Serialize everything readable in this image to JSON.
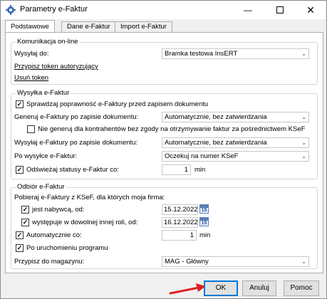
{
  "window": {
    "title": "Parametry e-Faktur",
    "close_glyph": "✕",
    "min_glyph": "—"
  },
  "tabs": [
    {
      "label": "Podstawowe",
      "active": true
    },
    {
      "label": "Dane e-Faktur",
      "active": false
    },
    {
      "label": "Import e-Faktur",
      "active": false
    }
  ],
  "komunikacja": {
    "title": "Komunikacja on-line",
    "send_to_label": "Wysyłaj do:",
    "send_to_value": "Bramka testowa InsERT",
    "assign_token_link": "Przypisz token autoryzujący",
    "remove_token_link": "Usuń token"
  },
  "wysylka": {
    "title": "Wysyłka e-Faktur",
    "validate_label": "Sprawdzaj poprawność e-Faktury przed zapisem dokumentu",
    "validate_checked": true,
    "generate_label": "Generuj e-Faktury po zapisie dokumentu:",
    "generate_value": "Automatycznie, bez zatwierdzania",
    "no_consent_label": "Nie generuj dla kontrahentów bez zgody na otrzymywanie faktur za pośrednictwem KSeF",
    "no_consent_checked": false,
    "send_after_save_label": "Wysyłaj e-Faktury po zapisie dokumentu:",
    "send_after_save_value": "Automatycznie, bez zatwierdzania",
    "after_send_label": "Po wysyłce e-Faktur:",
    "after_send_value": "Oczekuj na numer KSeF",
    "refresh_label": "Odświeżaj statusy e-Faktur co:",
    "refresh_checked": true,
    "refresh_value": "1",
    "refresh_unit": "min"
  },
  "odbior": {
    "title": "Odbiór  e-Faktur",
    "fetch_label": "Pobieraj e-Faktury z KSeF, dla których moja firma:",
    "buyer_label": "jest nabywcą, od:",
    "buyer_checked": true,
    "buyer_date": "15.12.2022",
    "other_role_label": "występuje w dowolnej innej roli, od:",
    "other_role_checked": true,
    "other_role_date": "16.12.2022",
    "calendar_day": "15",
    "auto_label": "Automatycznie co:",
    "auto_checked": true,
    "auto_value": "1",
    "auto_unit": "min",
    "on_start_label": "Po uruchomieniu programu",
    "on_start_checked": true,
    "warehouse_label": "Przypisz do magazynu:",
    "warehouse_value": "MAG - Główny"
  },
  "buttons": {
    "ok": "OK",
    "cancel": "Anuluj",
    "help": "Pomoc"
  },
  "colors": {
    "accent": "#0078d7",
    "annotation_arrow": "#e02020"
  }
}
